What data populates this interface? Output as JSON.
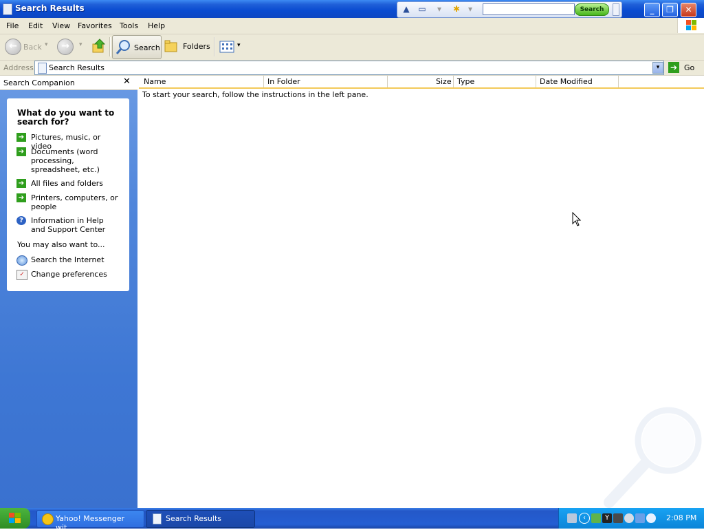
{
  "window": {
    "title": "Search Results"
  },
  "yahoo_toolbar": {
    "search_placeholder": "",
    "search_button": "Search"
  },
  "menu": {
    "items": [
      "File",
      "Edit",
      "View",
      "Favorites",
      "Tools",
      "Help"
    ]
  },
  "toolbar": {
    "back_label": "Back",
    "search_label": "Search",
    "folders_label": "Folders"
  },
  "address": {
    "label": "Address",
    "value": "Search Results",
    "go_label": "Go"
  },
  "left_pane": {
    "header": "Search Companion",
    "question": "What do you want to search for?",
    "options": [
      {
        "label": "Pictures, music, or video",
        "icon": "green-arrow-icon"
      },
      {
        "label": "Documents (word processing, spreadsheet, etc.)",
        "icon": "green-arrow-icon"
      },
      {
        "label": "All files and folders",
        "icon": "green-arrow-icon"
      },
      {
        "label": "Printers, computers, or people",
        "icon": "green-arrow-icon"
      },
      {
        "label": "Information in Help and Support Center",
        "icon": "help-icon"
      }
    ],
    "also_label": "You may also want to...",
    "also_items": [
      {
        "label": "Search the Internet",
        "icon": "internet-search-icon"
      },
      {
        "label": "Change preferences",
        "icon": "preferences-icon"
      }
    ]
  },
  "results": {
    "columns": [
      "Name",
      "In Folder",
      "Size",
      "Type",
      "Date Modified"
    ],
    "message": "To start your search, follow the instructions in the left pane."
  },
  "taskbar": {
    "tasks": [
      "Yahoo! Messenger wit...",
      "Search Results"
    ],
    "clock": "2:08 PM"
  },
  "colors": {
    "titlebar": "#0a4cd0",
    "left_pane": "#5086db",
    "taskbar": "#245ed3",
    "column_underline": "#f3c959"
  }
}
